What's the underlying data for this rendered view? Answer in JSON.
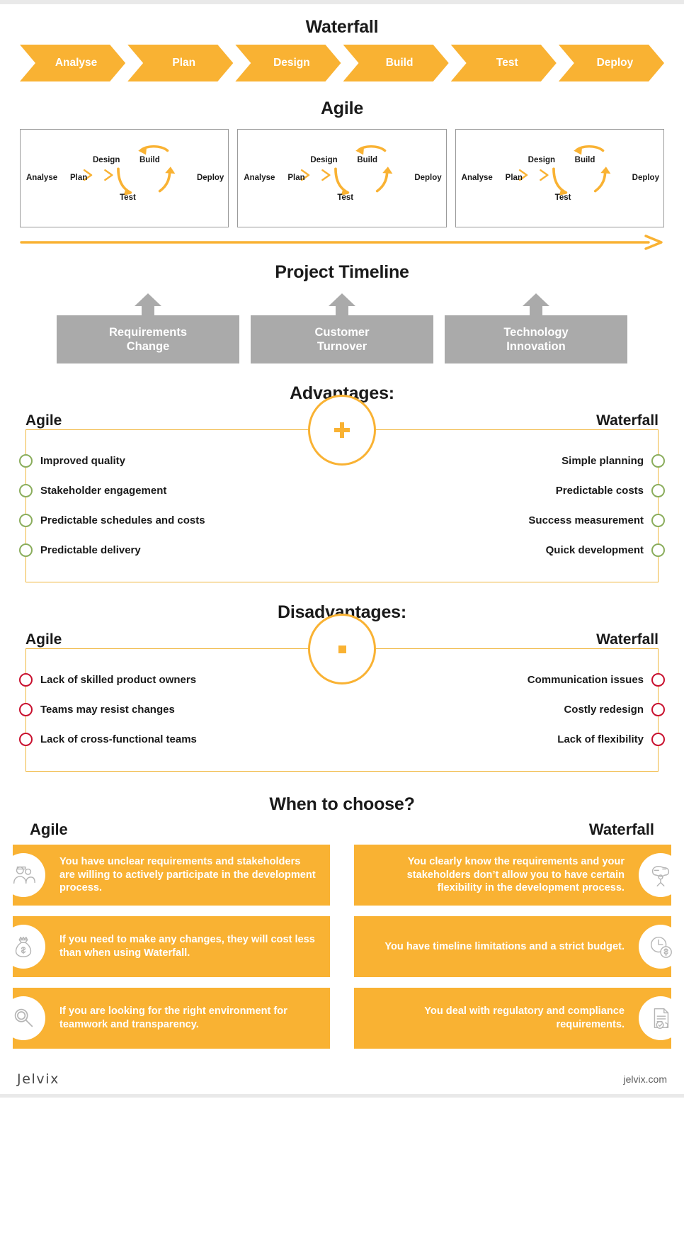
{
  "colors": {
    "accent_orange": "#f9b233",
    "gray_block": "#aaaaaa",
    "good_green": "#8aad5c",
    "bad_red": "#c8102e",
    "text_dark": "#1a1a1a",
    "card_text": "#ffffff"
  },
  "waterfall": {
    "title": "Waterfall",
    "phases": [
      "Analyse",
      "Plan",
      "Design",
      "Build",
      "Test",
      "Deploy"
    ]
  },
  "agile": {
    "title": "Agile",
    "iterations": [
      {
        "analyse": "Analyse",
        "plan": "Plan",
        "design": "Design",
        "build": "Build",
        "test": "Test",
        "deploy": "Deploy"
      },
      {
        "analyse": "Analyse",
        "plan": "Plan",
        "design": "Design",
        "build": "Build",
        "test": "Test",
        "deploy": "Deploy"
      },
      {
        "analyse": "Analyse",
        "plan": "Plan",
        "design": "Design",
        "build": "Build",
        "test": "Test",
        "deploy": "Deploy"
      }
    ]
  },
  "project_timeline": {
    "title": "Project Timeline",
    "blocks": [
      "Requirements\nChange",
      "Customer\nTurnover",
      "Technology\nInnovation"
    ],
    "blocks_lines": [
      [
        "Requirements",
        "Change"
      ],
      [
        "Customer",
        "Turnover"
      ],
      [
        "Technology",
        "Innovation"
      ]
    ]
  },
  "advantages": {
    "title": "Advantages:",
    "badge": "+",
    "left_header": "Agile",
    "right_header": "Waterfall",
    "left_items": [
      "Improved quality",
      "Stakeholder engagement",
      "Predictable schedules and costs",
      "Predictable delivery"
    ],
    "right_items": [
      "Simple planning",
      "Predictable costs",
      "Success measurement",
      "Quick development"
    ]
  },
  "disadvantages": {
    "title": "Disadvantages:",
    "badge": "-",
    "left_header": "Agile",
    "right_header": "Waterfall",
    "left_items": [
      "Lack of skilled product owners",
      "Teams may resist changes",
      "Lack of cross-functional teams"
    ],
    "right_items": [
      "Communication issues",
      "Costly redesign",
      "Lack of flexibility"
    ]
  },
  "when_to_choose": {
    "title": "When to choose?",
    "left_header": "Agile",
    "right_header": "Waterfall",
    "left_cards": [
      {
        "icon": "people-group-icon",
        "text": "You have unclear requirements and stakeholders are willing to actively participate in the development process."
      },
      {
        "icon": "money-bag-icon",
        "text": "If you need to make any changes, they will cost less than when using Waterfall."
      },
      {
        "icon": "magnifier-icon",
        "text": "If you are looking for the right environment for teamwork and transparency."
      }
    ],
    "right_cards": [
      {
        "icon": "strategy-head-icon",
        "text": "You clearly know the requirements and your stakeholders don’t allow you to have certain flexibility in the development process."
      },
      {
        "icon": "clock-budget-icon",
        "text": "You have timeline limitations and a strict budget."
      },
      {
        "icon": "compliance-document-icon",
        "text": "You deal with regulatory and compliance requirements."
      }
    ]
  },
  "footer": {
    "brand": "Jelvix",
    "site": "jelvix.com"
  }
}
